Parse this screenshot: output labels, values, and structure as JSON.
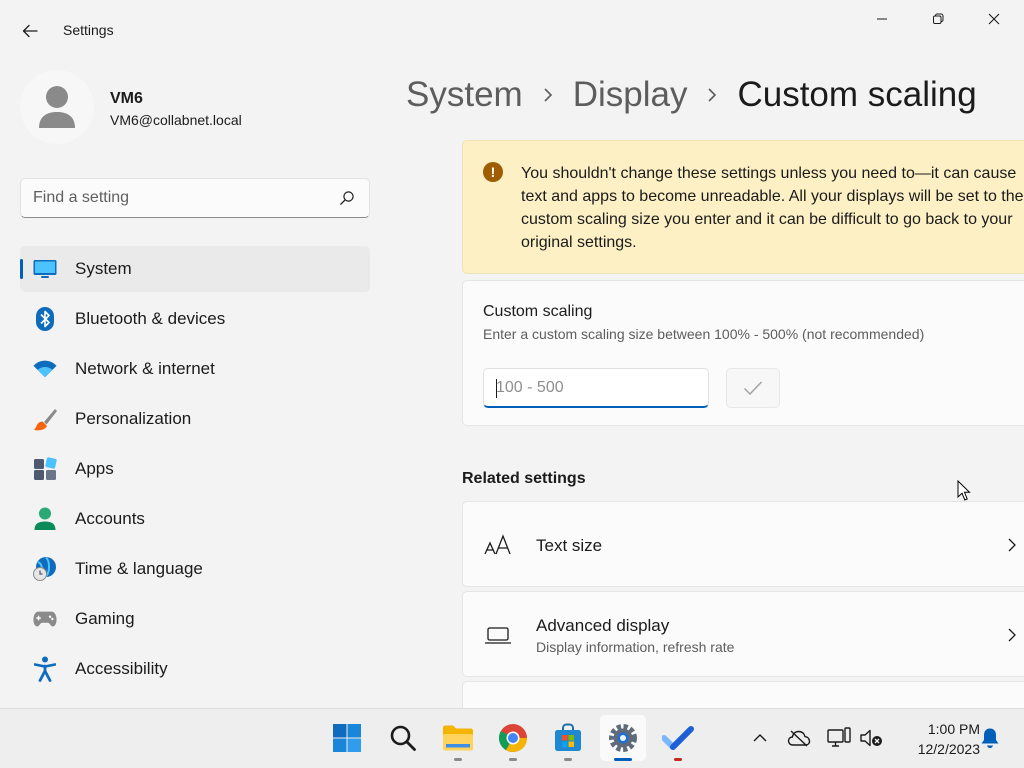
{
  "window": {
    "title": "Settings",
    "back_icon": "back-arrow-icon",
    "controls": [
      "minimize-icon",
      "restore-icon",
      "close-icon"
    ]
  },
  "profile": {
    "name": "VM6",
    "email": "VM6@collabnet.local"
  },
  "search": {
    "placeholder": "Find a setting",
    "icon": "search-icon"
  },
  "nav": {
    "items": [
      {
        "label": "System",
        "icon": "system-monitor-icon",
        "active": true
      },
      {
        "label": "Bluetooth & devices",
        "icon": "bluetooth-icon"
      },
      {
        "label": "Network & internet",
        "icon": "wifi-icon"
      },
      {
        "label": "Personalization",
        "icon": "paintbrush-icon"
      },
      {
        "label": "Apps",
        "icon": "apps-icon"
      },
      {
        "label": "Accounts",
        "icon": "accounts-icon"
      },
      {
        "label": "Time & language",
        "icon": "globe-clock-icon"
      },
      {
        "label": "Gaming",
        "icon": "gamepad-icon"
      },
      {
        "label": "Accessibility",
        "icon": "accessibility-icon"
      }
    ]
  },
  "breadcrumb": {
    "items": [
      "System",
      "Display",
      "Custom scaling"
    ]
  },
  "warning": {
    "icon_glyph": "!",
    "text": "You shouldn't change these settings unless you need to—it can cause text and apps to become unreadable. All your displays will be set to the custom scaling size you enter and it can be difficult to go back to your original settings."
  },
  "custom_scaling": {
    "title": "Custom scaling",
    "description": "Enter a custom scaling size between 100% - 500% (not recommended)",
    "input_value": "",
    "input_placeholder": "100 - 500",
    "apply_icon": "checkmark-icon"
  },
  "related": {
    "title": "Related settings",
    "items": [
      {
        "title": "Text size",
        "description": "",
        "icon": "text-size-icon"
      },
      {
        "title": "Advanced display",
        "description": "Display information, refresh rate",
        "icon": "laptop-display-icon"
      }
    ]
  },
  "colors": {
    "accent": "#005fb8",
    "warning_bg": "#fcf0c4",
    "warning_icon": "#9d5d00",
    "window_bg": "#f3f3f3",
    "card_bg": "#fbfbfb"
  },
  "taskbar": {
    "apps": [
      "windows-start-icon",
      "search-icon",
      "file-explorer-icon",
      "chrome-icon",
      "microsoft-store-icon",
      "settings-gear-icon",
      "todo-check-icon"
    ],
    "active_app": "settings-gear-icon",
    "tray": [
      "chevron-up-icon",
      "onedrive-offline-icon",
      "display-network-icon",
      "volume-muted-icon",
      "notification-bell-icon"
    ],
    "time": "1:00 PM",
    "date": "12/2/2023"
  }
}
